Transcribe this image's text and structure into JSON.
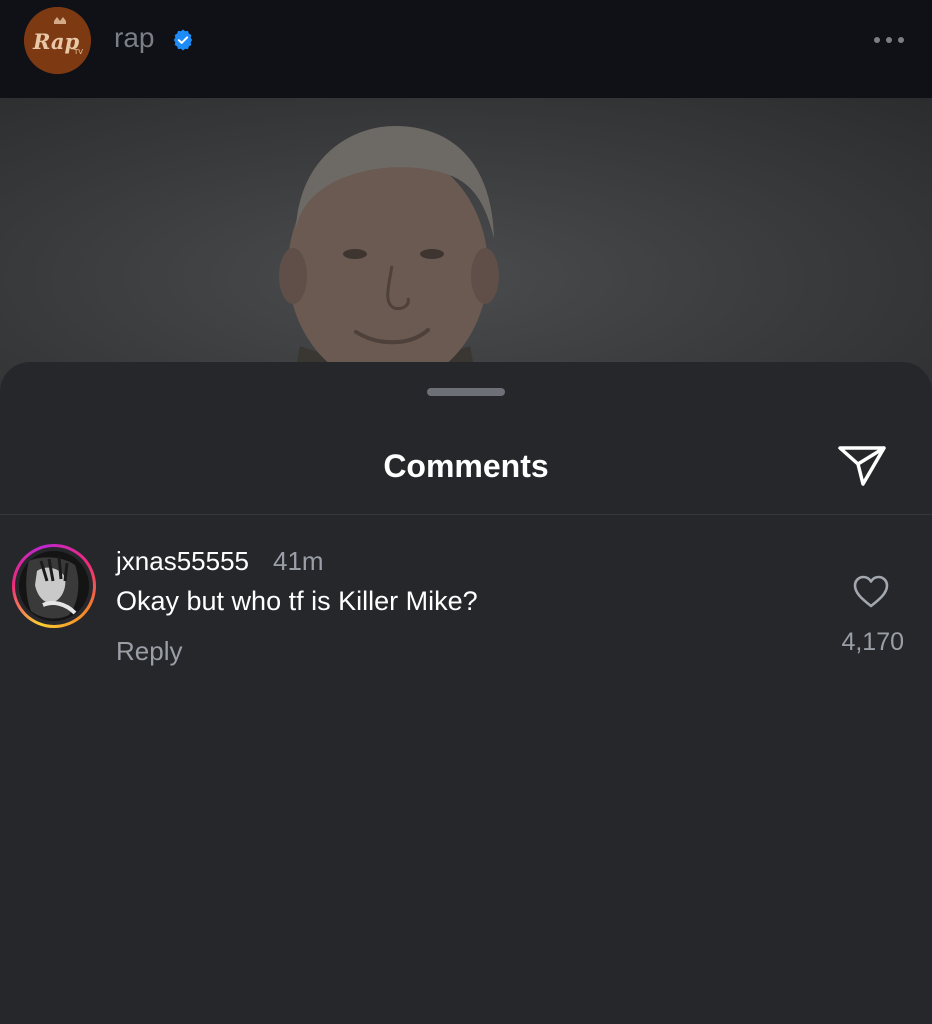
{
  "header": {
    "account_name": "rap",
    "logo_text": "Rap",
    "verified": true,
    "more_icon": "more-horizontal-icon"
  },
  "comments_sheet": {
    "title": "Comments",
    "share_icon": "paper-plane-icon"
  },
  "comments": [
    {
      "username": "jxnas55555",
      "time": "41m",
      "text": "Okay but who tf is Killer Mike?",
      "reply_label": "Reply",
      "like_count": "4,170",
      "like_icon": "heart-outline-icon"
    }
  ],
  "colors": {
    "background": "#0f1116",
    "sheet": "#25272b",
    "verified_blue": "#1d8cf8",
    "secondary_text": "#9a9ea6"
  }
}
